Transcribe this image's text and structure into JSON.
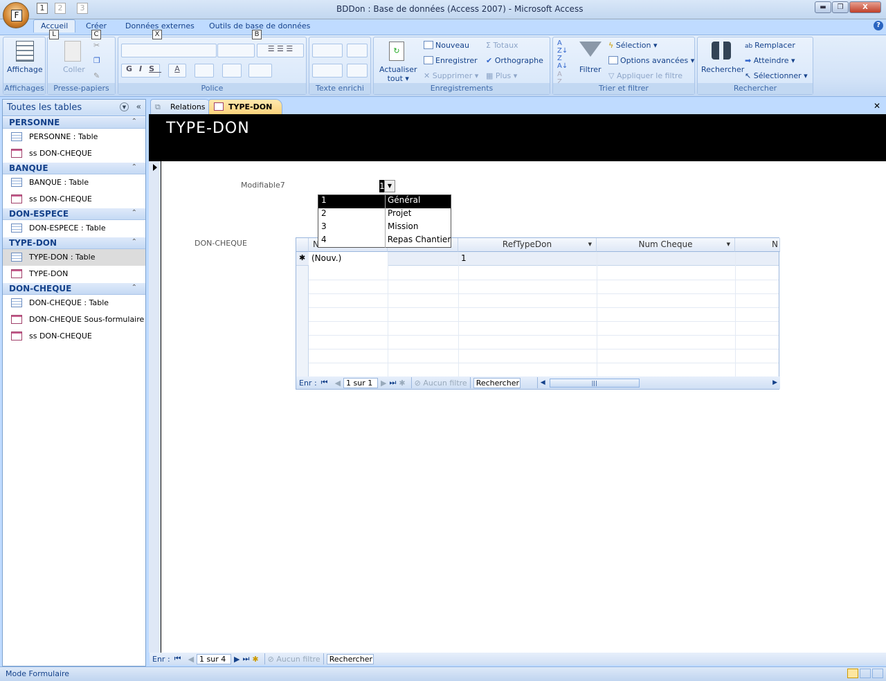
{
  "window": {
    "title": "BDDon : Base de données (Access 2007) - Microsoft Access",
    "office_keytip": "F",
    "qat_keytips": [
      "1",
      "2",
      "3"
    ],
    "minimize": "▬",
    "restore": "❐",
    "close": "X"
  },
  "ribbon": {
    "tabs": [
      {
        "label": "Accueil",
        "keytip": "L",
        "active": true
      },
      {
        "label": "Créer",
        "keytip": "C"
      },
      {
        "label": "Données externes",
        "keytip": "X"
      },
      {
        "label": "Outils de base de données",
        "keytip": "B"
      }
    ],
    "help": "?",
    "groups": {
      "affichages": {
        "label": "Affichages",
        "affichage": "Affichage"
      },
      "presse": {
        "label": "Presse-papiers",
        "coller": "Coller"
      },
      "police": {
        "label": "Police",
        "bold": "G",
        "italic": "I",
        "underline": "S",
        "fontcolor": "A"
      },
      "texte": {
        "label": "Texte enrichi"
      },
      "enreg": {
        "label": "Enregistrements",
        "actualiser": "Actualiser",
        "tout": "tout ▾",
        "nouveau": "Nouveau",
        "enregistrer": "Enregistrer",
        "supprimer": "Supprimer ▾",
        "totaux": "Totaux",
        "orthographe": "Orthographe",
        "plus": "Plus ▾"
      },
      "trier": {
        "label": "Trier et filtrer",
        "filtrer": "Filtrer",
        "selection": "Sélection ▾",
        "options": "Options avancées ▾",
        "appliquer": "Appliquer le filtre"
      },
      "rechercher": {
        "label": "Rechercher",
        "rechercher": "Rechercher",
        "remplacer": "Remplacer",
        "atteindre": "Atteindre ▾",
        "selectionner": "Sélectionner ▾"
      }
    }
  },
  "nav": {
    "title": "Toutes les tables",
    "groups": [
      {
        "name": "PERSONNE",
        "items": [
          {
            "label": "PERSONNE : Table",
            "type": "table"
          },
          {
            "label": "ss DON-CHEQUE",
            "type": "form"
          }
        ]
      },
      {
        "name": "BANQUE",
        "items": [
          {
            "label": "BANQUE : Table",
            "type": "table"
          },
          {
            "label": "ss DON-CHEQUE",
            "type": "form"
          }
        ]
      },
      {
        "name": "DON-ESPECE",
        "items": [
          {
            "label": "DON-ESPECE : Table",
            "type": "table"
          }
        ]
      },
      {
        "name": "TYPE-DON",
        "items": [
          {
            "label": "TYPE-DON : Table",
            "type": "table",
            "selected": true
          },
          {
            "label": "TYPE-DON",
            "type": "form"
          }
        ]
      },
      {
        "name": "DON-CHEQUE",
        "items": [
          {
            "label": "DON-CHEQUE : Table",
            "type": "table"
          },
          {
            "label": "DON-CHEQUE Sous-formulaire",
            "type": "form"
          },
          {
            "label": "ss DON-CHEQUE",
            "type": "form"
          }
        ]
      }
    ]
  },
  "doctabs": [
    {
      "label": "Relations"
    },
    {
      "label": "TYPE-DON",
      "active": true
    }
  ],
  "form": {
    "title": "TYPE-DON",
    "field_label": "Modifiable7",
    "combo_value": "1",
    "subform_label": "DON-CHEQUE",
    "dropdown": [
      [
        "1",
        "Général"
      ],
      [
        "2",
        "Projet"
      ],
      [
        "3",
        "Mission"
      ],
      [
        "4",
        "Repas Chantier"
      ]
    ],
    "datasheet": {
      "columns": [
        "N",
        "",
        "RefTypeDon",
        "Num Cheque",
        "N"
      ],
      "new_row": [
        "(Nouv.)",
        "",
        "1",
        "",
        ""
      ],
      "new_marker": "✱",
      "nav": {
        "label": "Enr :",
        "position": "1 sur 1",
        "filter": "Aucun filtre",
        "search": "Rechercher"
      }
    }
  },
  "recordnav": {
    "label": "Enr :",
    "position": "1 sur 4",
    "filter": "Aucun filtre",
    "search": "Rechercher"
  },
  "status": {
    "text": "Mode Formulaire"
  }
}
